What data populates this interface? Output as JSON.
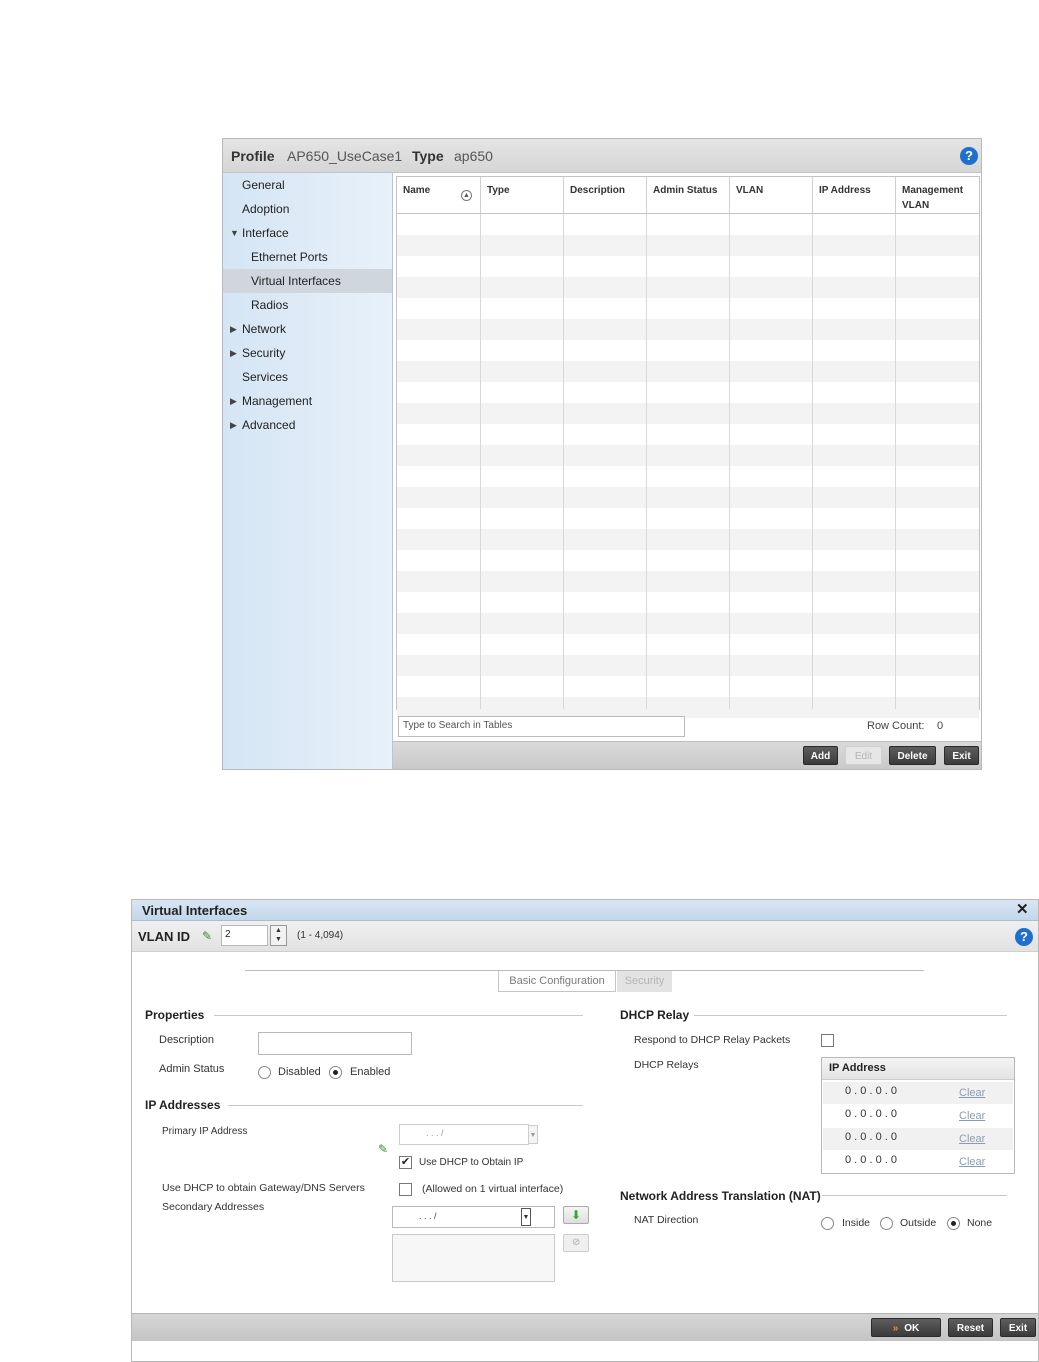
{
  "profile_panel": {
    "header": {
      "profile_label": "Profile",
      "profile_value": "AP650_UseCase1",
      "type_label": "Type",
      "type_value": "ap650",
      "help": "?"
    },
    "sidebar": [
      {
        "label": "General",
        "arrow": ""
      },
      {
        "label": "Adoption",
        "arrow": ""
      },
      {
        "label": "Interface",
        "arrow": "▼"
      },
      {
        "label": "Ethernet Ports",
        "arrow": ""
      },
      {
        "label": "Virtual Interfaces",
        "arrow": "",
        "selected": true
      },
      {
        "label": "Radios",
        "arrow": ""
      },
      {
        "label": "Network",
        "arrow": "▶"
      },
      {
        "label": "Security",
        "arrow": "▶"
      },
      {
        "label": "Services",
        "arrow": ""
      },
      {
        "label": "Management",
        "arrow": "▶"
      },
      {
        "label": "Advanced",
        "arrow": "▶"
      }
    ],
    "table": {
      "columns": [
        "Name",
        "Type",
        "Description",
        "Admin Status",
        "VLAN",
        "IP Address",
        "Management VLAN"
      ],
      "rows": []
    },
    "search_placeholder": "Type to Search in Tables",
    "row_count_label": "Row Count:",
    "row_count_value": "0",
    "buttons": {
      "add": "Add",
      "edit": "Edit",
      "delete": "Delete",
      "exit": "Exit"
    }
  },
  "virtual_interfaces_dialog": {
    "title": "Virtual Interfaces",
    "close": "✕",
    "vlan_label": "VLAN ID",
    "vlan_value": "2",
    "vlan_range": "(1 - 4,094)",
    "help": "?",
    "tabs": [
      "Basic Configuration",
      "Security"
    ],
    "properties": {
      "heading": "Properties",
      "description_label": "Description",
      "description_value": "",
      "admin_status_label": "Admin Status",
      "admin_status_options": [
        "Disabled",
        "Enabled"
      ],
      "admin_status_selected": "Enabled"
    },
    "ip_addresses": {
      "heading": "IP Addresses",
      "primary_label": "Primary IP Address",
      "primary_placeholder": ".     .     .     /",
      "use_dhcp_label": "Use DHCP to Obtain IP",
      "use_dhcp_checked": true,
      "gateway_label": "Use DHCP to obtain Gateway/DNS Servers",
      "gateway_note": "(Allowed on 1 virtual interface)",
      "gateway_checked": false,
      "secondary_label": "Secondary Addresses",
      "secondary_placeholder": ".     .     .     /"
    },
    "dhcp_relay": {
      "heading": "DHCP Relay",
      "respond_label": "Respond to DHCP Relay Packets",
      "respond_checked": false,
      "relays_label": "DHCP Relays",
      "relays_column": "IP Address",
      "relays": [
        {
          "ip": "0 . 0 . 0 . 0",
          "action": "Clear"
        },
        {
          "ip": "0 . 0 . 0 . 0",
          "action": "Clear"
        },
        {
          "ip": "0 . 0 . 0 . 0",
          "action": "Clear"
        },
        {
          "ip": "0 . 0 . 0 . 0",
          "action": "Clear"
        }
      ]
    },
    "nat": {
      "heading": "Network Address Translation (NAT)",
      "direction_label": "NAT Direction",
      "options": [
        "Inside",
        "Outside",
        "None"
      ],
      "selected": "None"
    },
    "buttons": {
      "ok": "OK",
      "reset": "Reset",
      "exit": "Exit"
    }
  }
}
